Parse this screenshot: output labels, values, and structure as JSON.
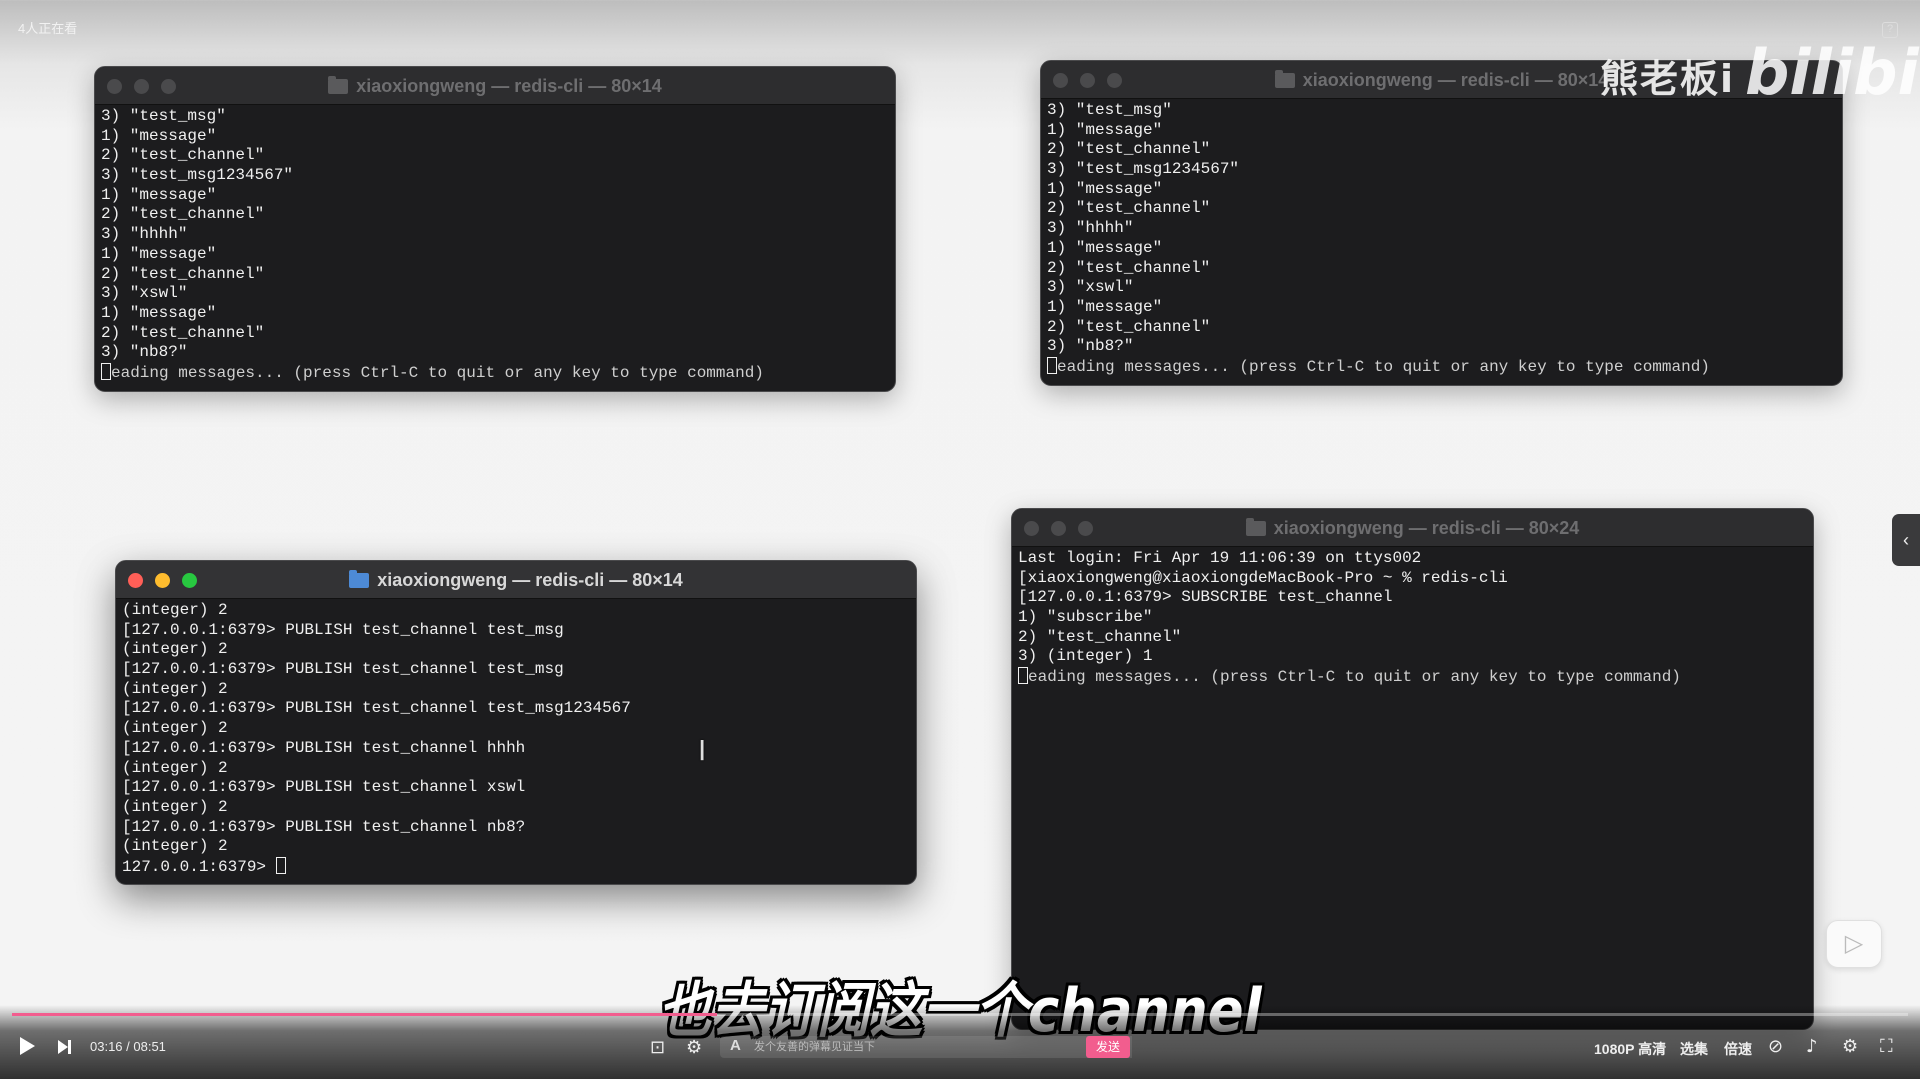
{
  "viewer_count": "4人正在看",
  "watermark": {
    "text": "熊老板i",
    "logo": "bilibili"
  },
  "terminals": [
    {
      "id": "tl",
      "title": "xiaoxiongweng — redis-cli — 80×14",
      "state": "inactive",
      "lines": [
        "3) \"test_msg\"",
        "1) \"message\"",
        "2) \"test_channel\"",
        "3) \"test_msg1234567\"",
        "1) \"message\"",
        "2) \"test_channel\"",
        "3) \"hhhh\"",
        "1) \"message\"",
        "2) \"test_channel\"",
        "3) \"xswl\"",
        "1) \"message\"",
        "2) \"test_channel\"",
        "3) \"nb8?\""
      ],
      "cursor_line": "eading messages... (press Ctrl-C to quit or any key to type command)"
    },
    {
      "id": "tr",
      "title": "xiaoxiongweng — redis-cli — 80×14",
      "state": "inactive",
      "lines": [
        "3) \"test_msg\"",
        "1) \"message\"",
        "2) \"test_channel\"",
        "3) \"test_msg1234567\"",
        "1) \"message\"",
        "2) \"test_channel\"",
        "3) \"hhhh\"",
        "1) \"message\"",
        "2) \"test_channel\"",
        "3) \"xswl\"",
        "1) \"message\"",
        "2) \"test_channel\"",
        "3) \"nb8?\""
      ],
      "cursor_line": "eading messages... (press Ctrl-C to quit or any key to type command)"
    },
    {
      "id": "bl",
      "title": "xiaoxiongweng — redis-cli — 80×14",
      "state": "active",
      "lines": [
        "(integer) 2",
        "[127.0.0.1:6379> PUBLISH test_channel test_msg",
        "(integer) 2",
        "[127.0.0.1:6379> PUBLISH test_channel test_msg",
        "(integer) 2",
        "[127.0.0.1:6379> PUBLISH test_channel test_msg1234567",
        "(integer) 2",
        "[127.0.0.1:6379> PUBLISH test_channel hhhh",
        "(integer) 2",
        "[127.0.0.1:6379> PUBLISH test_channel xswl",
        "(integer) 2",
        "[127.0.0.1:6379> PUBLISH test_channel nb8?",
        "(integer) 2"
      ],
      "prompt_line": "127.0.0.1:6379> "
    },
    {
      "id": "br",
      "title": "xiaoxiongweng — redis-cli — 80×24",
      "state": "inactive",
      "lines": [
        "Last login: Fri Apr 19 11:06:39 on ttys002",
        "[xiaoxiongweng@xiaoxiongdeMacBook-Pro ~ % redis-cli",
        "[127.0.0.1:6379> SUBSCRIBE test_channel",
        "1) \"subscribe\"",
        "2) \"test_channel\"",
        "3) (integer) 1"
      ],
      "cursor_line": "eading messages... (press Ctrl-C to quit or any key to type command)"
    }
  ],
  "subtitle": "也去订阅这一个channel",
  "player": {
    "time": "03:16 / 08:51",
    "progress_fraction": 0.372,
    "danmaku_placeholder": "发个友善的弹幕见证当下",
    "send_label": "发送",
    "quality_label": "1080P 高清",
    "episodes_label": "选集",
    "speed_label": "倍速",
    "accent_color": "#f25d8e"
  }
}
